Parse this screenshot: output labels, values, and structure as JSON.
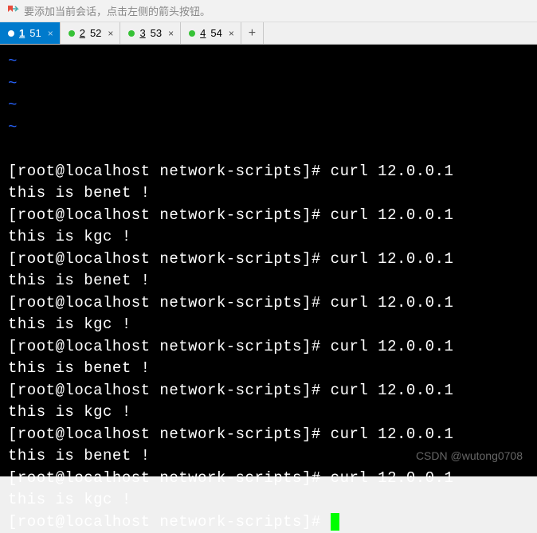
{
  "hint": "要添加当前会话，点击左侧的箭头按钮。",
  "tabs": [
    {
      "num": "1",
      "label": "51",
      "dot": "#ffffff",
      "active": true
    },
    {
      "num": "2",
      "label": "52",
      "dot": "#36c236",
      "active": false
    },
    {
      "num": "3",
      "label": "53",
      "dot": "#36c236",
      "active": false
    },
    {
      "num": "4",
      "label": "54",
      "dot": "#36c236",
      "active": false
    }
  ],
  "tildes": [
    "~",
    "~",
    "~",
    "~"
  ],
  "terminal": {
    "prompt": "[root@localhost network-scripts]# ",
    "command": "curl 12.0.0.1",
    "resp_benet": "this is benet !",
    "resp_kgc": "this is kgc !",
    "lines": [
      {
        "type": "cmd"
      },
      {
        "type": "benet"
      },
      {
        "type": "cmd"
      },
      {
        "type": "kgc"
      },
      {
        "type": "cmd"
      },
      {
        "type": "benet"
      },
      {
        "type": "cmd"
      },
      {
        "type": "kgc"
      },
      {
        "type": "cmd"
      },
      {
        "type": "benet"
      },
      {
        "type": "cmd"
      },
      {
        "type": "kgc"
      },
      {
        "type": "cmd"
      },
      {
        "type": "benet"
      },
      {
        "type": "cmd"
      },
      {
        "type": "kgc"
      },
      {
        "type": "prompt_only"
      }
    ]
  },
  "watermark": "CSDN @wutong0708"
}
